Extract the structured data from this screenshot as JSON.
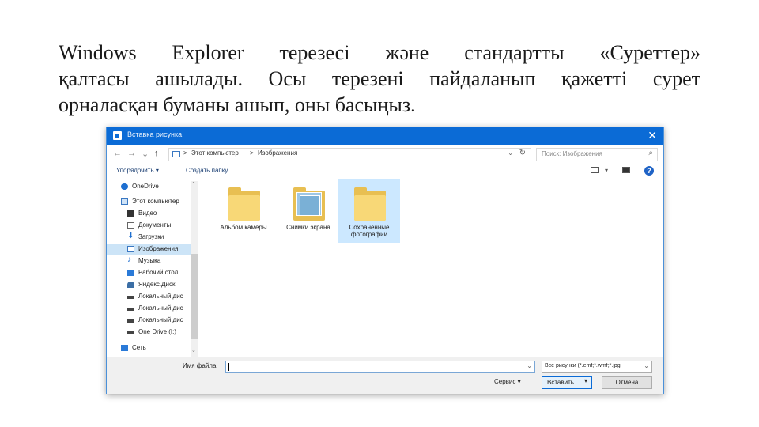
{
  "paragraph": {
    "line1": "Windows Explorer терезесі және стандартты «Суреттер»",
    "line2": "қалтасы ашылады. Осы терезені пайдаланып қажетті сурет",
    "line3": "орналасқан  буманы ашып, оны басыңыз."
  },
  "dialog": {
    "title": "Вставка рисунка",
    "close": "✕",
    "nav_buttons": [
      "←",
      "→",
      "⌄",
      "↑"
    ],
    "breadcrumb": [
      "Этот компьютер",
      "Изображения"
    ],
    "breadcrumb_sep": ">",
    "search_placeholder": "Поиск: Изображения",
    "commands": {
      "organize": "Упорядочить ▾",
      "new_folder": "Создать папку"
    },
    "help": "?",
    "sidebar": [
      {
        "label": "OneDrive",
        "icon": "cloud-icon"
      },
      {
        "label": "Этот компьютер",
        "icon": "computer-icon"
      },
      {
        "label": "Видео",
        "icon": "video-icon"
      },
      {
        "label": "Документы",
        "icon": "document-icon"
      },
      {
        "label": "Загрузки",
        "icon": "download-icon"
      },
      {
        "label": "Изображения",
        "icon": "pictures-icon",
        "selected": true
      },
      {
        "label": "Музыка",
        "icon": "music-icon"
      },
      {
        "label": "Рабочий стол",
        "icon": "desktop-icon"
      },
      {
        "label": "Яндекс.Диск",
        "icon": "yandex-disk-icon"
      },
      {
        "label": "Локальный дис",
        "icon": "drive-icon"
      },
      {
        "label": "Локальный дис",
        "icon": "drive-icon"
      },
      {
        "label": "Локальный дис",
        "icon": "drive-icon"
      },
      {
        "label": "One Drive (I:)",
        "icon": "drive-icon"
      },
      {
        "label": "Сеть",
        "icon": "network-icon"
      }
    ],
    "folders": [
      {
        "label": "Альбом камеры",
        "icon": "folder-icon"
      },
      {
        "label": "Снимки экрана",
        "icon": "folder-screenshots-icon"
      },
      {
        "label": "Сохраненные фотографии",
        "icon": "folder-icon",
        "selected": true
      }
    ],
    "filename_label": "Имя файла:",
    "filename_value": "",
    "filter_value": "Все рисунки (*.emf;*.wmf;*.jpg;",
    "service": "Сервис ▾",
    "insert": "Вставить",
    "cancel": "Отмена"
  },
  "colors": {
    "titlebar": "#0b6bd6",
    "selection": "#cce4f7",
    "folder": "#f8d877"
  }
}
